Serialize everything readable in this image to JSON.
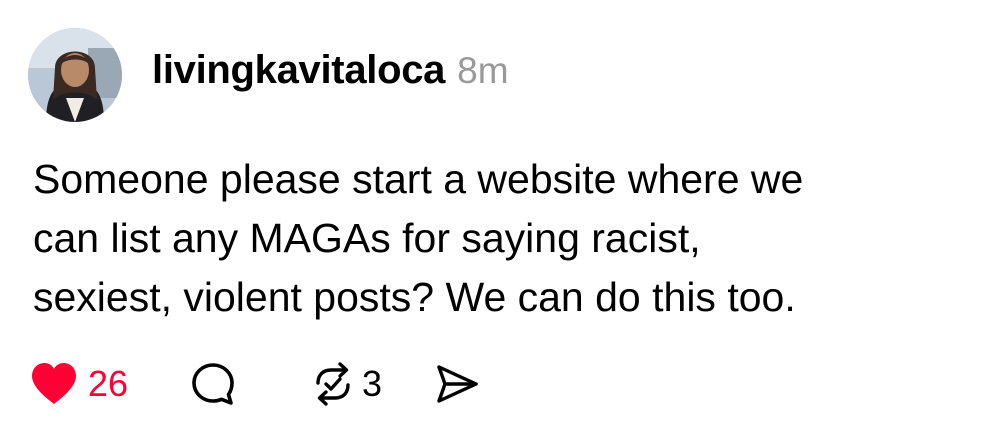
{
  "post": {
    "username": "livingkavitaloca",
    "timestamp": "8m",
    "text_lines": [
      "Someone please start a website where we",
      "can list any MAGAs for saying racist,",
      "sexiest, violent posts? We can do this too."
    ],
    "likes": "26",
    "reposts": "3"
  },
  "icons": {
    "like": "heart-icon",
    "reply": "speech-bubble-icon",
    "repost": "repost-arrows-icon",
    "share": "send-icon"
  },
  "colors": {
    "like_accent": "#ff0034",
    "timestamp": "#999999",
    "text": "#000000"
  }
}
